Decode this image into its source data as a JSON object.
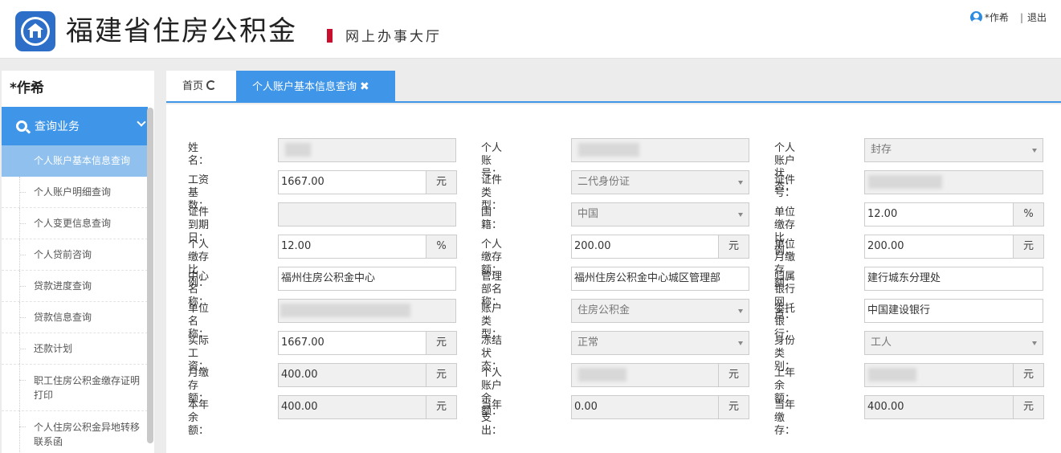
{
  "header": {
    "title": "福建省住房公积金",
    "subtitle": "网上办事大厅",
    "user": "*作希",
    "logout": "退出",
    "separator": "|"
  },
  "sidebar": {
    "user": "*作希",
    "menu_title": "查询业务",
    "items": [
      {
        "label": "个人账户基本信息查询"
      },
      {
        "label": "个人账户明细查询"
      },
      {
        "label": "个人变更信息查询"
      },
      {
        "label": "个人贷前咨询"
      },
      {
        "label": "贷款进度查询"
      },
      {
        "label": "贷款信息查询"
      },
      {
        "label": "还款计划"
      },
      {
        "label": "职工住房公积金缴存证明打印"
      },
      {
        "label": "个人住房公积金异地转移联系函"
      }
    ]
  },
  "tabs": {
    "home": "首页",
    "active": "个人账户基本信息查询",
    "close": "✖"
  },
  "form": {
    "name_label": "姓名：",
    "account_label": "个人账号：",
    "status_label": "个人账户状态：",
    "status_value": "封存",
    "salary_base_label": "工资基数：",
    "salary_base_value": "1667.00",
    "unit_yuan": "元",
    "id_type_label": "证件类型：",
    "id_type_value": "二代身份证",
    "id_no_label": "证件号：",
    "id_expire_label": "证件到期日：",
    "nationality_label": "国籍：",
    "nationality_value": "中国",
    "unit_ratio_label": "单位缴存比例：",
    "unit_ratio_value": "12.00",
    "unit_percent": "%",
    "person_ratio_label": "个人缴存比例：",
    "person_ratio_value": "12.00",
    "person_amount_label": "个人缴存额：",
    "person_amount_value": "200.00",
    "unit_month_label": "单位月缴存额：",
    "unit_month_value": "200.00",
    "center_label": "中心名称：",
    "center_value": "福州住房公积金中心",
    "dept_label": "管理部名称：",
    "dept_value": "福州住房公积金中心城区管理部",
    "bank_branch_label": "归属银行网点：",
    "bank_branch_value": "建行城东分理处",
    "company_label": "单位名称：",
    "account_type_label": "账户类型：",
    "account_type_value": "住房公积金",
    "trust_bank_label": "委托银行：",
    "trust_bank_value": "中国建设银行",
    "real_salary_label": "实际工资：",
    "real_salary_value": "1667.00",
    "freeze_label": "冻结状态：",
    "freeze_value": "正常",
    "identity_label": "身份类别：",
    "identity_value": "工人",
    "monthly_label": "月缴存额：",
    "monthly_value": "400.00",
    "balance_label": "个人账户余额：",
    "last_balance_label": "上年余额：",
    "year_balance_label": "本年余额：",
    "year_balance_value": "400.00",
    "year_out_label": "当年支出：",
    "year_out_value": "0.00",
    "year_in_label": "当年缴存：",
    "year_in_value": "400.00"
  }
}
